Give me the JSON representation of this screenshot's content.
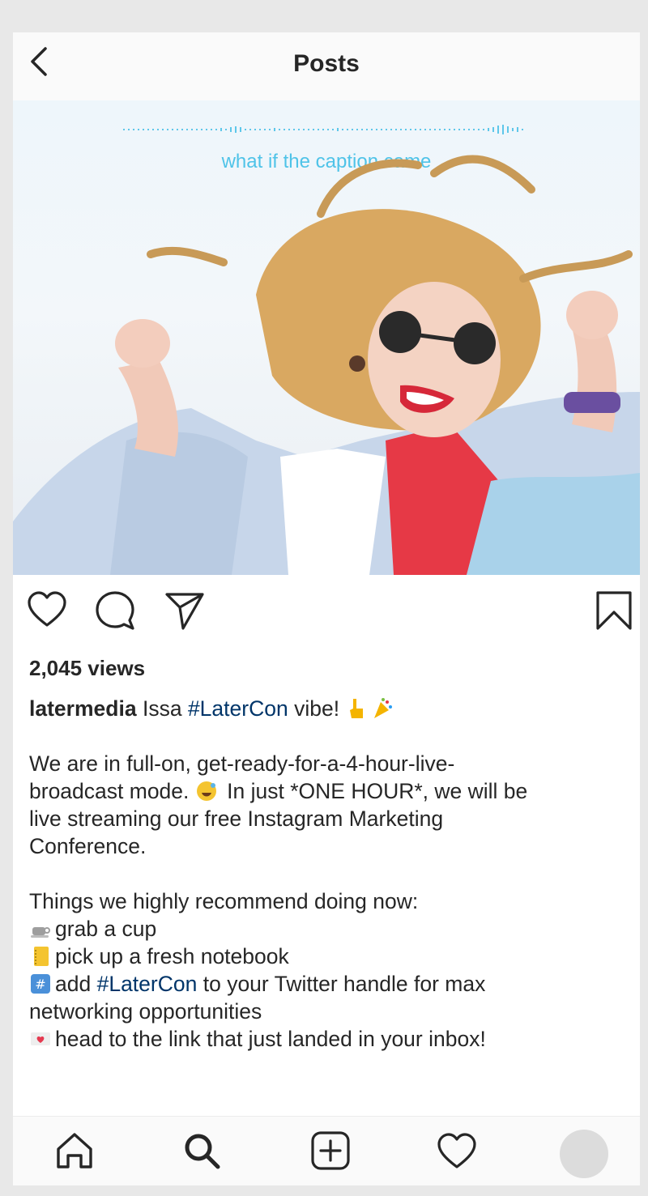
{
  "header": {
    "title": "Posts",
    "back_icon": "chevron-left-icon"
  },
  "post": {
    "overlay_caption": "what if the caption came",
    "views": "2,045 views",
    "username": "latermedia",
    "caption_line1_text": "Issa",
    "caption_line1_tag": "#LaterCon",
    "caption_line1_after": "vibe!",
    "para1_line1": "We are in full-on, get-ready-for-a-4-hour-live-",
    "para1_line2_before": "broadcast mode.",
    "para1_line2_after": "In just *ONE HOUR*, we will be",
    "para1_line3": "live streaming our free Instagram Marketing",
    "para1_line4": "Conference.",
    "para2_heading": "Things we highly recommend doing now:",
    "item1": "grab a cup",
    "item2": "pick up a fresh notebook",
    "item3_before": "add",
    "item3_tag": "#LaterCon",
    "item3_after": "to your Twitter handle for max",
    "item3_cont": "networking opportunities",
    "item4": "head to the link that just landed in your inbox!"
  },
  "actions": [
    "heart-icon",
    "comment-icon",
    "share-icon",
    "bookmark-icon"
  ],
  "bottom_nav": [
    "home-icon",
    "search-icon",
    "add-post-icon",
    "activity-heart-icon",
    "profile-avatar"
  ],
  "colors": {
    "accent_overlay": "#4fc3e8",
    "hashtag": "#003569",
    "text": "#262626"
  }
}
